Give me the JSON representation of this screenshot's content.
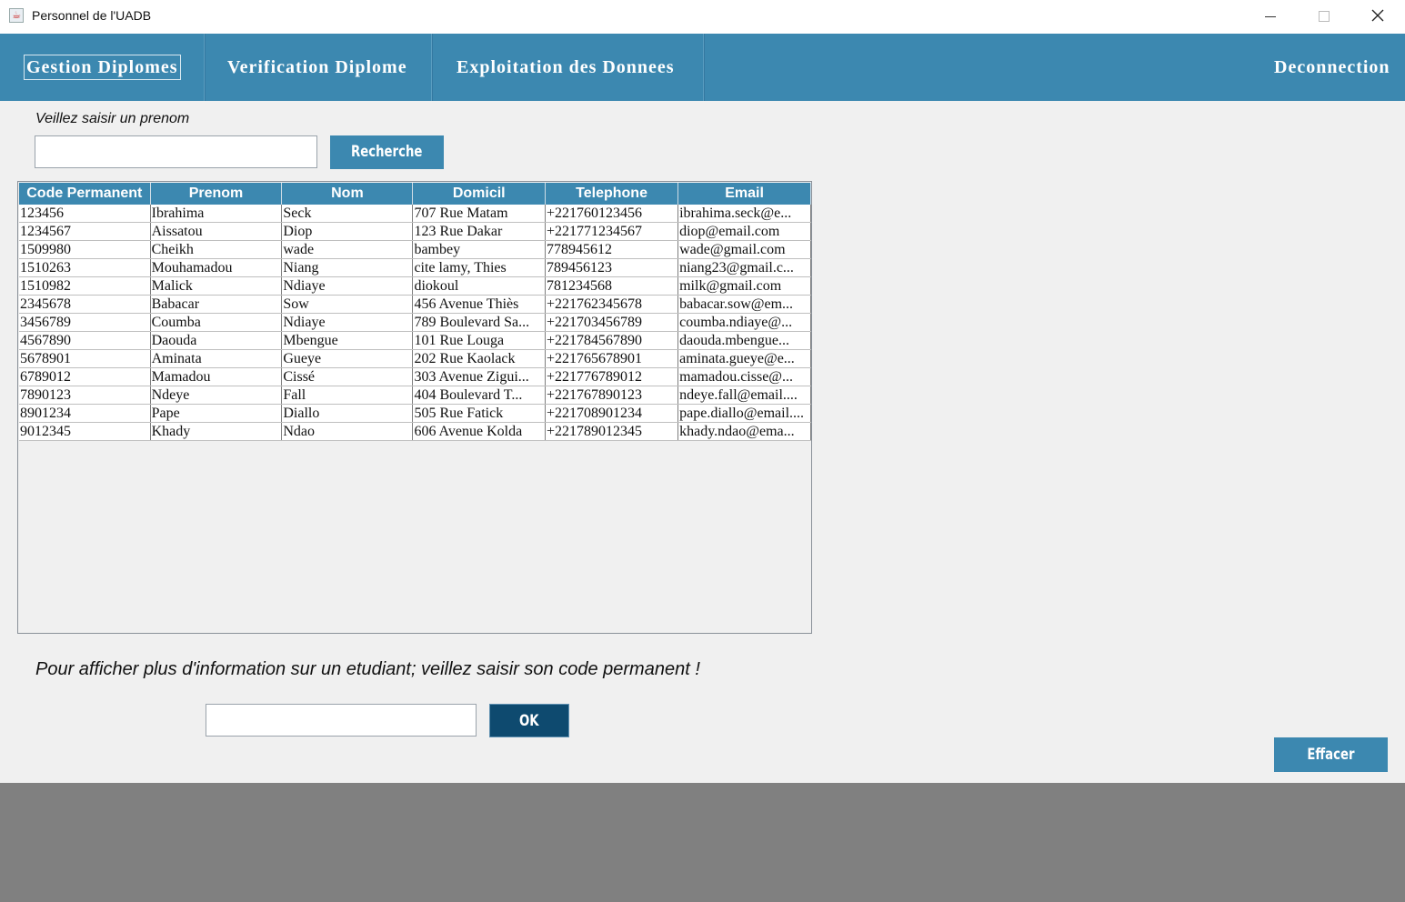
{
  "window": {
    "title": "Personnel de l'UADB",
    "minimize_icon": "minimize-icon",
    "maximize_icon": "maximize-icon",
    "close_icon": "close-icon"
  },
  "menu": {
    "items": [
      "Gestion Diplomes",
      "Verification Diplome",
      "Exploitation des Donnees"
    ],
    "logout": "Deconnection"
  },
  "search": {
    "prompt": "Veillez saisir un prenom",
    "value": "",
    "button": "Recherche"
  },
  "table": {
    "columns": [
      "Code Permanent",
      "Prenom",
      "Nom",
      "Domicil",
      "Telephone",
      "Email"
    ],
    "rows": [
      [
        "123456",
        "Ibrahima",
        "Seck",
        "707 Rue Matam",
        "+221760123456",
        "ibrahima.seck@e..."
      ],
      [
        "1234567",
        "Aissatou",
        "Diop",
        "123 Rue Dakar",
        "+221771234567",
        "diop@email.com"
      ],
      [
        "1509980",
        "Cheikh",
        "wade",
        "bambey",
        "778945612",
        "wade@gmail.com"
      ],
      [
        "1510263",
        "Mouhamadou",
        "Niang",
        "cite lamy, Thies",
        "789456123",
        "niang23@gmail.c..."
      ],
      [
        "1510982",
        "Malick",
        "Ndiaye",
        "diokoul",
        "781234568",
        "milk@gmail.com"
      ],
      [
        "2345678",
        "Babacar",
        "Sow",
        "456 Avenue Thiès",
        "+221762345678",
        "babacar.sow@em..."
      ],
      [
        "3456789",
        "Coumba",
        "Ndiaye",
        "789 Boulevard Sa...",
        "+221703456789",
        "coumba.ndiaye@..."
      ],
      [
        "4567890",
        "Daouda",
        "Mbengue",
        "101 Rue Louga",
        "+221784567890",
        "daouda.mbengue..."
      ],
      [
        "5678901",
        "Aminata",
        "Gueye",
        "202 Rue Kaolack",
        "+221765678901",
        "aminata.gueye@e..."
      ],
      [
        "6789012",
        "Mamadou",
        "Cissé",
        "303 Avenue Zigui...",
        "+221776789012",
        "mamadou.cisse@..."
      ],
      [
        "7890123",
        "Ndeye",
        "Fall",
        "404 Boulevard T...",
        "+221767890123",
        "ndeye.fall@email...."
      ],
      [
        "8901234",
        "Pape",
        "Diallo",
        "505 Rue Fatick",
        "+221708901234",
        "pape.diallo@email...."
      ],
      [
        "9012345",
        "Khady",
        "Ndao",
        "606 Avenue Kolda",
        "+221789012345",
        "khady.ndao@ema..."
      ]
    ]
  },
  "details": {
    "prompt": "Pour afficher plus d'information sur un etudiant; veillez saisir son code permanent !",
    "value": "",
    "button": "OK"
  },
  "actions": {
    "clear": "Effacer"
  },
  "colors": {
    "accent": "#3c88b0",
    "dark_button": "#0e4a6f",
    "background": "#f0f0f0",
    "footer": "#808080"
  }
}
